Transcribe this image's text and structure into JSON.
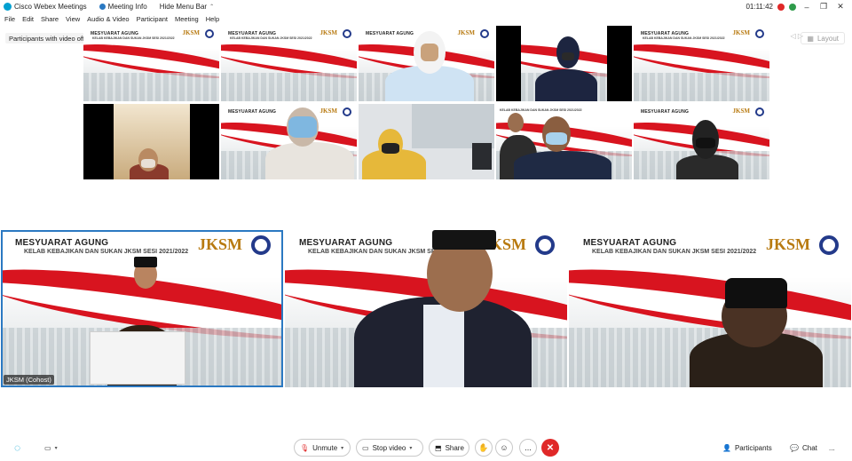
{
  "titlebar": {
    "app_name": "Cisco Webex Meetings",
    "meeting_info": "Meeting Info",
    "hide_menu": "Hide Menu Bar",
    "time": "01:11:42",
    "brand_color": "#00a0d1"
  },
  "menu": [
    "File",
    "Edit",
    "Share",
    "View",
    "Audio & Video",
    "Participant",
    "Meeting",
    "Help"
  ],
  "participants_hidden": "Participants with video off: 102 hidden",
  "layout_label": "Layout",
  "slide": {
    "title": "MESYUARAT AGUNG",
    "subtitle_small": "KELAB KEBAJIKAN DAN SUKAN JKSM SESI 2021/2022",
    "subtitle_large": "KELAB KEBAJIKAN DAN SUKAN JKSM SESI 2021/2022",
    "logo_text": "JKSM"
  },
  "main_speaker_name": "JKSM (Cohost)",
  "toolbar": {
    "unmute": "Unmute",
    "stop_video": "Stop video",
    "share": "Share",
    "participants": "Participants",
    "chat": "Chat",
    "more": "...",
    "end_color": "#e02828"
  }
}
